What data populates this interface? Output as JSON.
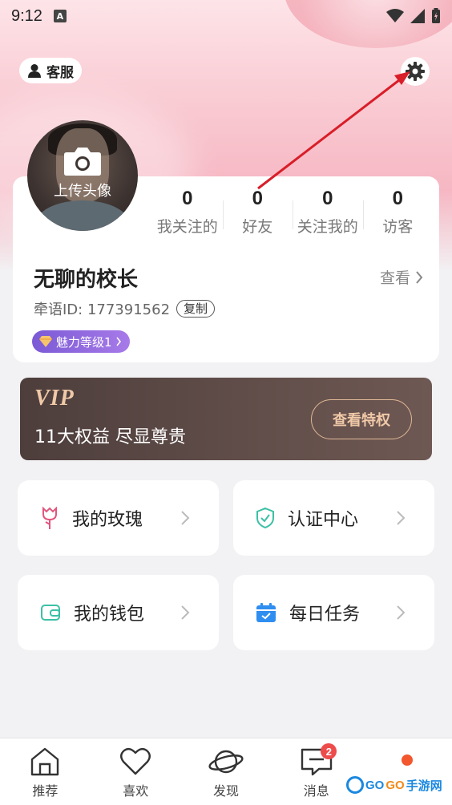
{
  "status_bar": {
    "time": "9:12",
    "notification_icon": "A"
  },
  "header": {
    "service_label": "客服"
  },
  "profile": {
    "upload_label": "上传头像",
    "stats": [
      {
        "value": "0",
        "label": "我关注的"
      },
      {
        "value": "0",
        "label": "好友"
      },
      {
        "value": "0",
        "label": "关注我的"
      },
      {
        "value": "0",
        "label": "访客"
      }
    ],
    "nickname": "无聊的校长",
    "view_label": "查看",
    "id_text": "牵语ID: 177391562",
    "copy_label": "复制",
    "charm_label": "魅力等级1"
  },
  "vip": {
    "title": "VIP",
    "subtitle": "11大权益 尽显尊贵",
    "button_label": "查看特权"
  },
  "menu": [
    {
      "label": "我的玫瑰",
      "icon": "rose-icon"
    },
    {
      "label": "认证中心",
      "icon": "shield-check-icon"
    },
    {
      "label": "我的钱包",
      "icon": "wallet-icon"
    },
    {
      "label": "每日任务",
      "icon": "calendar-icon"
    }
  ],
  "tabbar": [
    {
      "label": "推荐",
      "icon": "home-icon"
    },
    {
      "label": "喜欢",
      "icon": "heart-icon"
    },
    {
      "label": "发现",
      "icon": "planet-icon"
    },
    {
      "label": "消息",
      "icon": "message-icon",
      "badge": "2"
    },
    {
      "label": "",
      "icon": "dot-indicator"
    }
  ],
  "watermark": {
    "go1": "GO",
    "go2": "GO",
    "rest": "手游网"
  },
  "colors": {
    "accent_purple": "#8a63dc",
    "vip_gold": "#f0c9a8",
    "badge_red": "#ee4b4b",
    "arrow_red": "#d81e28"
  }
}
